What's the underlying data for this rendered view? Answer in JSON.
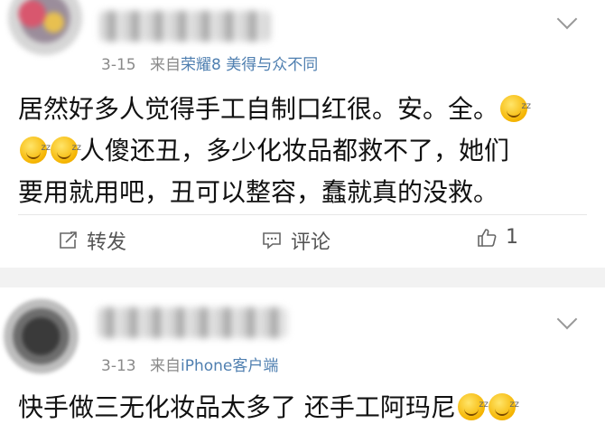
{
  "posts": [
    {
      "meta": {
        "date": "3-15",
        "source_prefix": "来自",
        "source": "荣耀8 美得与众不同"
      },
      "content_lines": [
        "居然好多人觉得手工自制口红很。安。全。",
        "人傻还丑，多少化妆品都救不了，她们",
        "要用就用吧，丑可以整容，蠢就真的没救。"
      ],
      "emoji": "sleepy-grin-emoji",
      "actions": {
        "repost": "转发",
        "comment": "评论",
        "like_count": "1"
      }
    },
    {
      "meta": {
        "date": "3-13",
        "source_prefix": "来自",
        "source": "iPhone客户端"
      },
      "content_lines": [
        "快手做三无化妆品太多了 还手工阿玛尼"
      ],
      "emoji": "sleepy-grin-emoji"
    }
  ],
  "colors": {
    "background": "#ffffff",
    "separator": "#f2f2f2",
    "link": "#4f7fb0",
    "meta": "#8a8a8a"
  }
}
